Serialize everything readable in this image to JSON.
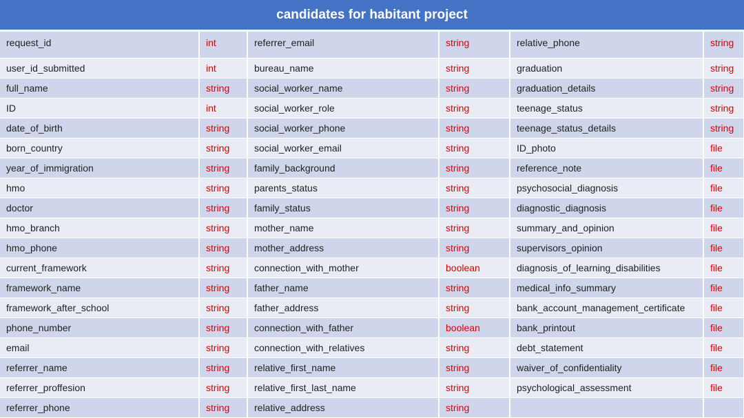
{
  "title": "candidates for habitant project",
  "rows": [
    [
      {
        "name": "request_id",
        "type": "int"
      },
      {
        "name": "referrer_email",
        "type": "string"
      },
      {
        "name": "relative_phone",
        "type": "string"
      }
    ],
    [
      {
        "name": "user_id_submitted",
        "type": "int"
      },
      {
        "name": "bureau_name",
        "type": "string"
      },
      {
        "name": "graduation",
        "type": "string"
      }
    ],
    [
      {
        "name": "full_name",
        "type": "string"
      },
      {
        "name": "social_worker_name",
        "type": "string"
      },
      {
        "name": "graduation_details",
        "type": "string"
      }
    ],
    [
      {
        "name": "ID",
        "type": "int"
      },
      {
        "name": "social_worker_role",
        "type": "string"
      },
      {
        "name": "teenage_status",
        "type": "string"
      }
    ],
    [
      {
        "name": "date_of_birth",
        "type": "string"
      },
      {
        "name": "social_worker_phone",
        "type": "string"
      },
      {
        "name": "teenage_status_details",
        "type": "string"
      }
    ],
    [
      {
        "name": "born_country",
        "type": "string"
      },
      {
        "name": "social_worker_email",
        "type": "string"
      },
      {
        "name": "ID_photo",
        "type": "file"
      }
    ],
    [
      {
        "name": "year_of_immigration",
        "type": "string"
      },
      {
        "name": "family_background",
        "type": "string"
      },
      {
        "name": "reference_note",
        "type": "file"
      }
    ],
    [
      {
        "name": "hmo",
        "type": "string"
      },
      {
        "name": "parents_status",
        "type": "string"
      },
      {
        "name": "psychosocial_diagnosis",
        "type": "file"
      }
    ],
    [
      {
        "name": "doctor",
        "type": "string"
      },
      {
        "name": "family_status",
        "type": "string"
      },
      {
        "name": "diagnostic_diagnosis",
        "type": "file"
      }
    ],
    [
      {
        "name": "hmo_branch",
        "type": "string"
      },
      {
        "name": "mother_name",
        "type": "string"
      },
      {
        "name": "summary_and_opinion",
        "type": "file"
      }
    ],
    [
      {
        "name": "hmo_phone",
        "type": "string"
      },
      {
        "name": "mother_address",
        "type": "string"
      },
      {
        "name": "supervisors_opinion",
        "type": "file"
      }
    ],
    [
      {
        "name": "current_framework",
        "type": "string"
      },
      {
        "name": "connection_with_mother",
        "type": "boolean"
      },
      {
        "name": "diagnosis_of_learning_disabilities",
        "type": "file"
      }
    ],
    [
      {
        "name": "framework_name",
        "type": "string"
      },
      {
        "name": "father_name",
        "type": "string"
      },
      {
        "name": "medical_info_summary",
        "type": "file"
      }
    ],
    [
      {
        "name": "framework_after_school",
        "type": "string"
      },
      {
        "name": "father_address",
        "type": "string"
      },
      {
        "name": "bank_account_management_certificate",
        "type": "file"
      }
    ],
    [
      {
        "name": "phone_number",
        "type": "string"
      },
      {
        "name": "connection_with_father",
        "type": "boolean"
      },
      {
        "name": "bank_printout",
        "type": "file"
      }
    ],
    [
      {
        "name": "email",
        "type": "string"
      },
      {
        "name": "connection_with_relatives",
        "type": "string"
      },
      {
        "name": "debt_statement",
        "type": "file"
      }
    ],
    [
      {
        "name": "referrer_name",
        "type": "string"
      },
      {
        "name": "relative_first_name",
        "type": "string"
      },
      {
        "name": "waiver_of_confidentiality",
        "type": "file"
      }
    ],
    [
      {
        "name": "referrer_proffesion",
        "type": "string"
      },
      {
        "name": "relative_first_last_name",
        "type": "string"
      },
      {
        "name": "psychological_assessment",
        "type": "file"
      }
    ],
    [
      {
        "name": "referrer_phone",
        "type": "string"
      },
      {
        "name": "relative_address",
        "type": "string"
      },
      {
        "name": "",
        "type": ""
      }
    ]
  ]
}
